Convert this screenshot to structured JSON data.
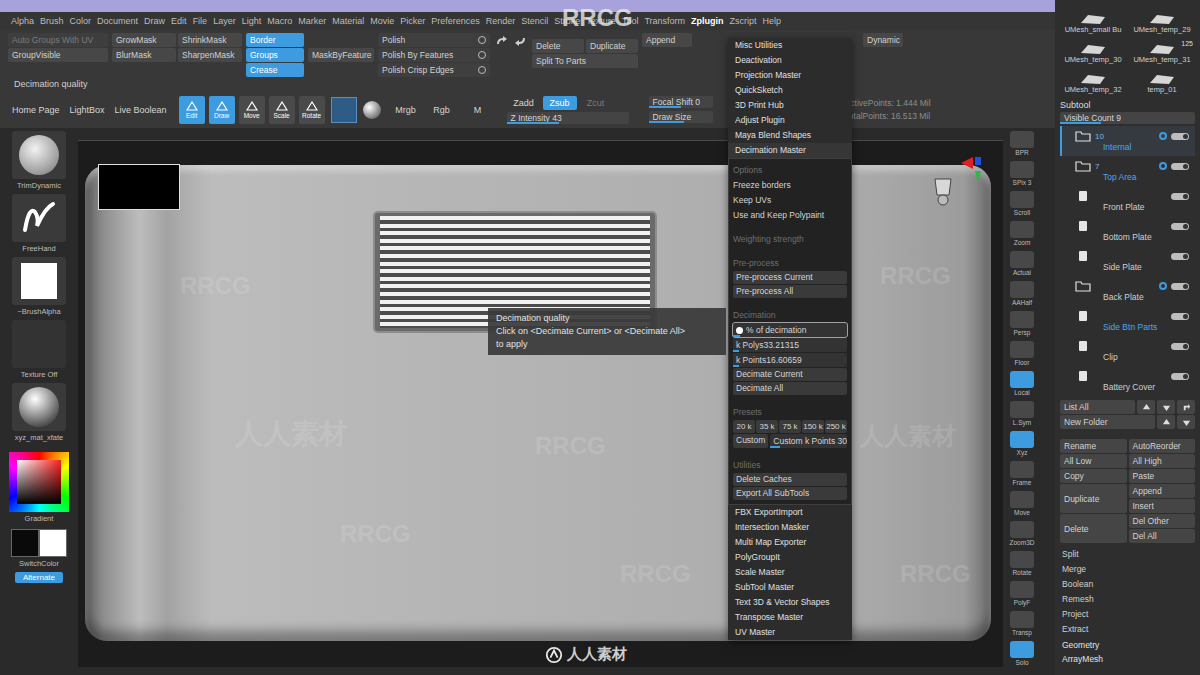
{
  "top_menu": [
    {
      "label": "Alpha",
      "selected": false
    },
    {
      "label": "Brush",
      "selected": false
    },
    {
      "label": "Color",
      "selected": false
    },
    {
      "label": "Document",
      "selected": false
    },
    {
      "label": "Draw",
      "selected": false
    },
    {
      "label": "Edit",
      "selected": false
    },
    {
      "label": "File",
      "selected": false
    },
    {
      "label": "Layer",
      "selected": false
    },
    {
      "label": "Light",
      "selected": false
    },
    {
      "label": "Macro",
      "selected": false
    },
    {
      "label": "Marker",
      "selected": false
    },
    {
      "label": "Material",
      "selected": false
    },
    {
      "label": "Movie",
      "selected": false
    },
    {
      "label": "Picker",
      "selected": false
    },
    {
      "label": "Preferences",
      "selected": false
    },
    {
      "label": "Render",
      "selected": false
    },
    {
      "label": "Stencil",
      "selected": false
    },
    {
      "label": "Stroke",
      "selected": false
    },
    {
      "label": "Texture",
      "selected": false
    },
    {
      "label": "Tool",
      "selected": false
    },
    {
      "label": "Transform",
      "selected": false
    },
    {
      "label": "Zplugin",
      "selected": true
    },
    {
      "label": "Zscript",
      "selected": false
    },
    {
      "label": "Help",
      "selected": false
    }
  ],
  "toolbar": {
    "groups": [
      {
        "kind": "stack",
        "items": [
          {
            "label": "Auto Groups With UV",
            "on": false,
            "disabled": true
          },
          {
            "label": "GroupVisible",
            "on": false,
            "disabled": false
          }
        ]
      },
      {
        "kind": "grid",
        "items": [
          {
            "label": "GrowMask",
            "on": false,
            "disabled": false
          },
          {
            "label": "ShrinkMask",
            "on": false,
            "disabled": false
          },
          {
            "label": "BlurMask",
            "on": false,
            "disabled": false
          },
          {
            "label": "SharpenMask",
            "on": false,
            "disabled": false
          }
        ]
      },
      {
        "kind": "stack",
        "items": [
          {
            "label": "Border",
            "on": true,
            "disabled": false
          },
          {
            "label": "Groups",
            "on": true,
            "disabled": false
          },
          {
            "label": "Crease",
            "on": true,
            "disabled": false
          }
        ]
      },
      {
        "kind": "stack",
        "items": [
          {
            "label": "MaskByFeature",
            "on": false,
            "disabled": false
          }
        ]
      },
      {
        "kind": "slider",
        "items": [
          {
            "label": "Polish",
            "on": false,
            "disabled": false
          },
          {
            "label": "Polish By Features",
            "on": false,
            "disabled": false
          },
          {
            "label": "Polish Crisp Edges",
            "on": false,
            "disabled": false
          }
        ]
      },
      {
        "kind": "icons",
        "items": []
      },
      {
        "kind": "grid",
        "items": [
          {
            "label": "Delete",
            "on": false,
            "disabled": false
          },
          {
            "label": "Duplicate",
            "on": false,
            "disabled": false
          },
          {
            "label": "Split To Parts",
            "on": false,
            "disabled": false
          }
        ]
      },
      {
        "kind": "stack",
        "items": [
          {
            "label": "Append",
            "on": false,
            "disabled": false
          }
        ]
      },
      {
        "kind": "stack",
        "items": [
          {
            "label": "Dynamic",
            "on": false,
            "disabled": false
          }
        ]
      }
    ],
    "status_label": "Decimation quality",
    "nav": [
      "Home Page",
      "LightBox",
      "Live Boolean"
    ],
    "tools": [
      {
        "label": "Edit",
        "on": true
      },
      {
        "label": "Draw",
        "on": true
      },
      {
        "label": "Move",
        "on": false
      },
      {
        "label": "Scale",
        "on": false
      },
      {
        "label": "Rotate",
        "on": false
      }
    ],
    "rgb_modes": [
      {
        "label": "Mrgb",
        "on": false
      },
      {
        "label": "Rgb",
        "on": false
      },
      {
        "label": "M",
        "on": false
      }
    ],
    "z_modes": [
      {
        "label": "Zadd",
        "on": false,
        "disabled": false
      },
      {
        "label": "Zsub",
        "on": true,
        "disabled": false
      },
      {
        "label": "Zcut",
        "on": false,
        "disabled": true
      }
    ],
    "z_intensity": {
      "label": "Z Intensity",
      "value": "43",
      "level": 0.43
    },
    "focal_shift": {
      "label": "Focal Shift",
      "value": "0",
      "level": 0.5
    },
    "draw_size": {
      "label": "Draw Size",
      "level": 0.55
    },
    "stats": [
      "ActivePoints: 1.444 Mil",
      "TotalPoints: 16.513 Mil"
    ]
  },
  "left_shelf": {
    "items": [
      {
        "label": "TrimDynamic",
        "kind": "brush"
      },
      {
        "label": "FreeHand",
        "kind": "stroke"
      },
      {
        "label": "~BrushAlpha",
        "kind": "alpha"
      },
      {
        "label": "Texture Off",
        "kind": "texture"
      },
      {
        "label": "xyz_mat_xfate",
        "kind": "material"
      }
    ],
    "picker_label": "Gradient",
    "swatches": {
      "label": "SwitchColor",
      "colors": [
        "#0a0a0a",
        "#ffffff"
      ]
    },
    "alternate": {
      "label": "Alternate",
      "on": true
    }
  },
  "right_shelf": [
    {
      "label": "BPR",
      "on": false
    },
    {
      "label": "SPix 3",
      "on": false
    },
    {
      "label": "Scroll",
      "on": false
    },
    {
      "label": "Zoom",
      "on": false
    },
    {
      "label": "Actual",
      "on": false
    },
    {
      "label": "AAHalf",
      "on": false
    },
    {
      "label": "Persp",
      "on": false
    },
    {
      "label": "Floor",
      "on": false
    },
    {
      "label": "Local",
      "on": true
    },
    {
      "label": "L.Sym",
      "on": false
    },
    {
      "label": "Xyz",
      "on": true
    },
    {
      "label": "Frame",
      "on": false
    },
    {
      "label": "Move",
      "on": false
    },
    {
      "label": "Zoom3D",
      "on": false
    },
    {
      "label": "Rotate",
      "on": false
    },
    {
      "label": "PolyF",
      "on": false
    },
    {
      "label": "Transp",
      "on": false
    },
    {
      "label": "Solo",
      "on": true
    }
  ],
  "subtool": {
    "thumbs": [
      {
        "label": "UMesh_small Bu",
        "badge": ""
      },
      {
        "label": "UMesh_temp_29",
        "badge": ""
      },
      {
        "label": "UMesh_temp_30",
        "badge": ""
      },
      {
        "label": "UMesh_temp_31",
        "badge": "125"
      },
      {
        "label": "UMesh_temp_32",
        "badge": ""
      },
      {
        "label": "temp_01",
        "badge": ""
      }
    ],
    "title": "Subtool",
    "visible_count": {
      "label": "Visible Count",
      "value": "9",
      "level": 0.3
    },
    "items": [
      {
        "name": "Internal",
        "kind": "folder",
        "count": "10",
        "selected": true,
        "highlighted": true
      },
      {
        "name": "Top Area",
        "kind": "folder",
        "count": "7",
        "selected": false,
        "highlighted": true
      },
      {
        "name": "Front Plate",
        "kind": "mesh",
        "count": "",
        "selected": false,
        "highlighted": false
      },
      {
        "name": "Bottom Plate",
        "kind": "mesh",
        "count": "",
        "selected": false,
        "highlighted": false
      },
      {
        "name": "Side Plate",
        "kind": "mesh",
        "count": "",
        "selected": false,
        "highlighted": false
      },
      {
        "name": "Back Plate",
        "kind": "folder",
        "count": "",
        "selected": false,
        "highlighted": false
      },
      {
        "name": "Side Btn Parts",
        "kind": "mesh",
        "count": "",
        "selected": false,
        "highlighted": true
      },
      {
        "name": "Clip",
        "kind": "mesh",
        "count": "",
        "selected": false,
        "highlighted": false
      },
      {
        "name": "Battery Cover",
        "kind": "mesh",
        "count": "",
        "selected": false,
        "highlighted": false
      }
    ],
    "list_controls": [
      "List All",
      "New Folder"
    ],
    "actions": [
      {
        "left": "Rename",
        "right": [
          "AutoReorder"
        ]
      },
      {
        "left": "All Low",
        "right": [
          "All High"
        ]
      },
      {
        "left": "Copy",
        "right": [
          "Paste"
        ]
      },
      {
        "left": "Duplicate",
        "right": [
          "Append",
          "Insert"
        ]
      },
      {
        "left": "Delete",
        "right": [
          "Del Other",
          "Del All"
        ]
      }
    ],
    "more": [
      "Split",
      "Merge",
      "Boolean",
      "Remesh",
      "Project",
      "Extract"
    ],
    "sections": [
      "Geometry",
      "ArrayMesh"
    ]
  },
  "zplugin_menu": {
    "items_before": [
      "Misc Utilities",
      "Deactivation",
      "Projection Master",
      "QuickSketch",
      "3D Print Hub",
      "Adjust Plugin",
      "Maya Blend Shapes"
    ],
    "expanded": {
      "label": "Decimation Master",
      "rows": [
        {
          "kind": "header",
          "label": "Options"
        },
        {
          "kind": "toggle",
          "label": "Freeze borders",
          "on": false
        },
        {
          "kind": "toggle",
          "label": "Keep UVs",
          "on": false
        },
        {
          "kind": "toggle",
          "label": "Use and Keep Polypaint",
          "on": false
        },
        {
          "kind": "header",
          "label": "Weighting strength"
        },
        {
          "kind": "header",
          "label": "Pre-process"
        },
        {
          "kind": "button",
          "label": "Pre-process Current"
        },
        {
          "kind": "button",
          "label": "Pre-process All"
        },
        {
          "kind": "header",
          "label": "Decimation"
        },
        {
          "kind": "slider",
          "label": "% of decimation",
          "value": "",
          "level": 0.06,
          "focused": true
        },
        {
          "kind": "slider",
          "label": "k Polys",
          "value": "33.21315",
          "level": 0.05,
          "focused": false
        },
        {
          "kind": "slider",
          "label": "k Points",
          "value": "16.60659",
          "level": 0.05,
          "focused": false
        },
        {
          "kind": "button",
          "label": "Decimate Current"
        },
        {
          "kind": "button",
          "label": "Decimate All"
        },
        {
          "kind": "header",
          "label": "Presets"
        },
        {
          "kind": "presets",
          "labels": [
            "20 k",
            "35 k",
            "75 k",
            "150 k",
            "250 k"
          ]
        },
        {
          "kind": "custom",
          "label": "Custom",
          "slider": {
            "label": "Custom k Points",
            "value": "30",
            "level": 0.12
          }
        },
        {
          "kind": "header",
          "label": "Utilities"
        },
        {
          "kind": "button",
          "label": "Delete Caches"
        },
        {
          "kind": "button",
          "label": "Export All SubTools"
        }
      ]
    },
    "items_after": [
      "FBX ExportImport",
      "Intersection Masker",
      "Multi Map Exporter",
      "PolyGroupIt",
      "Scale Master",
      "SubTool Master",
      "Text 3D & Vector Shapes",
      "Transpose Master",
      "UV Master"
    ]
  },
  "tooltip": {
    "title": "Decimation quality",
    "lines": [
      "Click on <Decimate Current> or <Decimate All>",
      "to apply"
    ]
  },
  "watermarks": [
    {
      "text": "RRCG"
    },
    {
      "text": "RRCG"
    },
    {
      "text": "RRCG"
    },
    {
      "text": "RRCG"
    },
    {
      "text": "RRCG"
    },
    {
      "text": "RRCG"
    },
    {
      "text": "人人素材"
    },
    {
      "text": "人人素材"
    },
    {
      "text": "RRCG"
    }
  ],
  "logo": {
    "text": "人人素材"
  }
}
